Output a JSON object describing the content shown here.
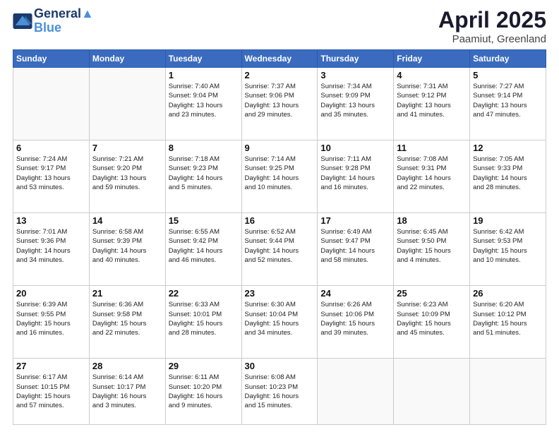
{
  "header": {
    "logo_line1": "General",
    "logo_line2": "Blue",
    "month": "April 2025",
    "location": "Paamiut, Greenland"
  },
  "days_of_week": [
    "Sunday",
    "Monday",
    "Tuesday",
    "Wednesday",
    "Thursday",
    "Friday",
    "Saturday"
  ],
  "weeks": [
    [
      {
        "day": "",
        "info": ""
      },
      {
        "day": "",
        "info": ""
      },
      {
        "day": "1",
        "info": "Sunrise: 7:40 AM\nSunset: 9:04 PM\nDaylight: 13 hours\nand 23 minutes."
      },
      {
        "day": "2",
        "info": "Sunrise: 7:37 AM\nSunset: 9:06 PM\nDaylight: 13 hours\nand 29 minutes."
      },
      {
        "day": "3",
        "info": "Sunrise: 7:34 AM\nSunset: 9:09 PM\nDaylight: 13 hours\nand 35 minutes."
      },
      {
        "day": "4",
        "info": "Sunrise: 7:31 AM\nSunset: 9:12 PM\nDaylight: 13 hours\nand 41 minutes."
      },
      {
        "day": "5",
        "info": "Sunrise: 7:27 AM\nSunset: 9:14 PM\nDaylight: 13 hours\nand 47 minutes."
      }
    ],
    [
      {
        "day": "6",
        "info": "Sunrise: 7:24 AM\nSunset: 9:17 PM\nDaylight: 13 hours\nand 53 minutes."
      },
      {
        "day": "7",
        "info": "Sunrise: 7:21 AM\nSunset: 9:20 PM\nDaylight: 13 hours\nand 59 minutes."
      },
      {
        "day": "8",
        "info": "Sunrise: 7:18 AM\nSunset: 9:23 PM\nDaylight: 14 hours\nand 5 minutes."
      },
      {
        "day": "9",
        "info": "Sunrise: 7:14 AM\nSunset: 9:25 PM\nDaylight: 14 hours\nand 10 minutes."
      },
      {
        "day": "10",
        "info": "Sunrise: 7:11 AM\nSunset: 9:28 PM\nDaylight: 14 hours\nand 16 minutes."
      },
      {
        "day": "11",
        "info": "Sunrise: 7:08 AM\nSunset: 9:31 PM\nDaylight: 14 hours\nand 22 minutes."
      },
      {
        "day": "12",
        "info": "Sunrise: 7:05 AM\nSunset: 9:33 PM\nDaylight: 14 hours\nand 28 minutes."
      }
    ],
    [
      {
        "day": "13",
        "info": "Sunrise: 7:01 AM\nSunset: 9:36 PM\nDaylight: 14 hours\nand 34 minutes."
      },
      {
        "day": "14",
        "info": "Sunrise: 6:58 AM\nSunset: 9:39 PM\nDaylight: 14 hours\nand 40 minutes."
      },
      {
        "day": "15",
        "info": "Sunrise: 6:55 AM\nSunset: 9:42 PM\nDaylight: 14 hours\nand 46 minutes."
      },
      {
        "day": "16",
        "info": "Sunrise: 6:52 AM\nSunset: 9:44 PM\nDaylight: 14 hours\nand 52 minutes."
      },
      {
        "day": "17",
        "info": "Sunrise: 6:49 AM\nSunset: 9:47 PM\nDaylight: 14 hours\nand 58 minutes."
      },
      {
        "day": "18",
        "info": "Sunrise: 6:45 AM\nSunset: 9:50 PM\nDaylight: 15 hours\nand 4 minutes."
      },
      {
        "day": "19",
        "info": "Sunrise: 6:42 AM\nSunset: 9:53 PM\nDaylight: 15 hours\nand 10 minutes."
      }
    ],
    [
      {
        "day": "20",
        "info": "Sunrise: 6:39 AM\nSunset: 9:55 PM\nDaylight: 15 hours\nand 16 minutes."
      },
      {
        "day": "21",
        "info": "Sunrise: 6:36 AM\nSunset: 9:58 PM\nDaylight: 15 hours\nand 22 minutes."
      },
      {
        "day": "22",
        "info": "Sunrise: 6:33 AM\nSunset: 10:01 PM\nDaylight: 15 hours\nand 28 minutes."
      },
      {
        "day": "23",
        "info": "Sunrise: 6:30 AM\nSunset: 10:04 PM\nDaylight: 15 hours\nand 34 minutes."
      },
      {
        "day": "24",
        "info": "Sunrise: 6:26 AM\nSunset: 10:06 PM\nDaylight: 15 hours\nand 39 minutes."
      },
      {
        "day": "25",
        "info": "Sunrise: 6:23 AM\nSunset: 10:09 PM\nDaylight: 15 hours\nand 45 minutes."
      },
      {
        "day": "26",
        "info": "Sunrise: 6:20 AM\nSunset: 10:12 PM\nDaylight: 15 hours\nand 51 minutes."
      }
    ],
    [
      {
        "day": "27",
        "info": "Sunrise: 6:17 AM\nSunset: 10:15 PM\nDaylight: 15 hours\nand 57 minutes."
      },
      {
        "day": "28",
        "info": "Sunrise: 6:14 AM\nSunset: 10:17 PM\nDaylight: 16 hours\nand 3 minutes."
      },
      {
        "day": "29",
        "info": "Sunrise: 6:11 AM\nSunset: 10:20 PM\nDaylight: 16 hours\nand 9 minutes."
      },
      {
        "day": "30",
        "info": "Sunrise: 6:08 AM\nSunset: 10:23 PM\nDaylight: 16 hours\nand 15 minutes."
      },
      {
        "day": "",
        "info": ""
      },
      {
        "day": "",
        "info": ""
      },
      {
        "day": "",
        "info": ""
      }
    ]
  ]
}
